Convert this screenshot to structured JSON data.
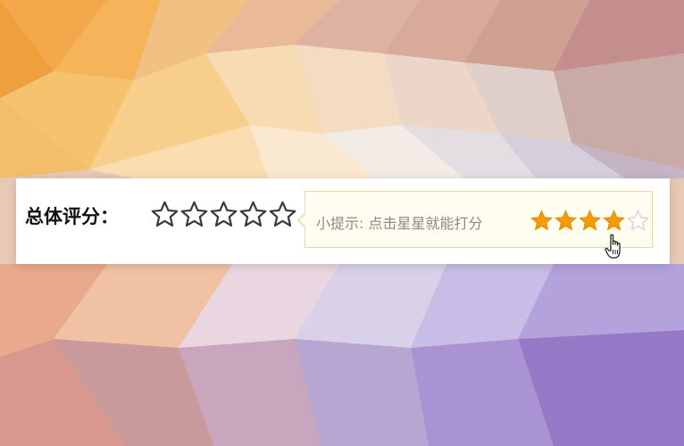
{
  "rating": {
    "label": "总体评分：",
    "max_stars": 5,
    "selected": 0
  },
  "tip": {
    "text": "小提示: 点击星星就能打分",
    "demo_filled_stars": 4,
    "demo_total_stars": 5
  },
  "colors": {
    "star_outline": "#3a3a3a",
    "star_filled": "#f59a00",
    "star_empty_demo": "#d8d8d8"
  },
  "icons": {
    "rating_star": "star-outline-icon",
    "demo_star_filled": "star-filled-icon",
    "demo_star_empty": "star-empty-icon",
    "cursor": "hand-pointer-icon"
  }
}
